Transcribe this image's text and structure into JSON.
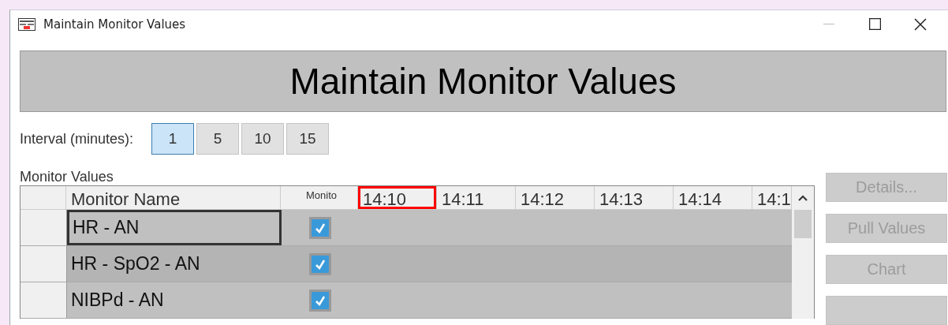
{
  "window": {
    "title": "Maintain Monitor Values",
    "controls": [
      {
        "kind": "minimize",
        "disabled": true
      },
      {
        "kind": "maximize",
        "disabled": false
      },
      {
        "kind": "close",
        "disabled": false
      }
    ]
  },
  "banner": "Maintain Monitor Values",
  "interval": {
    "label": "Interval (minutes):",
    "options": [
      {
        "label": "1",
        "selected": true
      },
      {
        "label": "5",
        "selected": false
      },
      {
        "label": "10",
        "selected": false
      },
      {
        "label": "15",
        "selected": false
      }
    ]
  },
  "grid": {
    "label": "Monitor Values",
    "columns": [
      {
        "label": "Monitor Name",
        "kind": "name",
        "highlighted": false
      },
      {
        "label": "Monito",
        "kind": "check",
        "highlighted": false
      },
      {
        "label": "14:10",
        "kind": "time",
        "highlighted": true
      },
      {
        "label": "14:11",
        "kind": "time",
        "highlighted": false
      },
      {
        "label": "14:12",
        "kind": "time",
        "highlighted": false
      },
      {
        "label": "14:13",
        "kind": "time",
        "highlighted": false
      },
      {
        "label": "14:14",
        "kind": "time",
        "highlighted": false
      },
      {
        "label": "14:1",
        "kind": "partial",
        "highlighted": false
      }
    ],
    "rows": [
      {
        "name": "HR - AN",
        "monitored": true,
        "selected": true
      },
      {
        "name": "HR - SpO2 - AN",
        "monitored": true,
        "selected": false
      },
      {
        "name": "NIBPd - AN",
        "monitored": true,
        "selected": false
      }
    ]
  },
  "buttons": [
    {
      "label": "Details...",
      "disabled": true
    },
    {
      "label": "Pull Values",
      "disabled": true
    },
    {
      "label": "Chart",
      "disabled": true
    },
    {
      "disabled": true
    }
  ]
}
